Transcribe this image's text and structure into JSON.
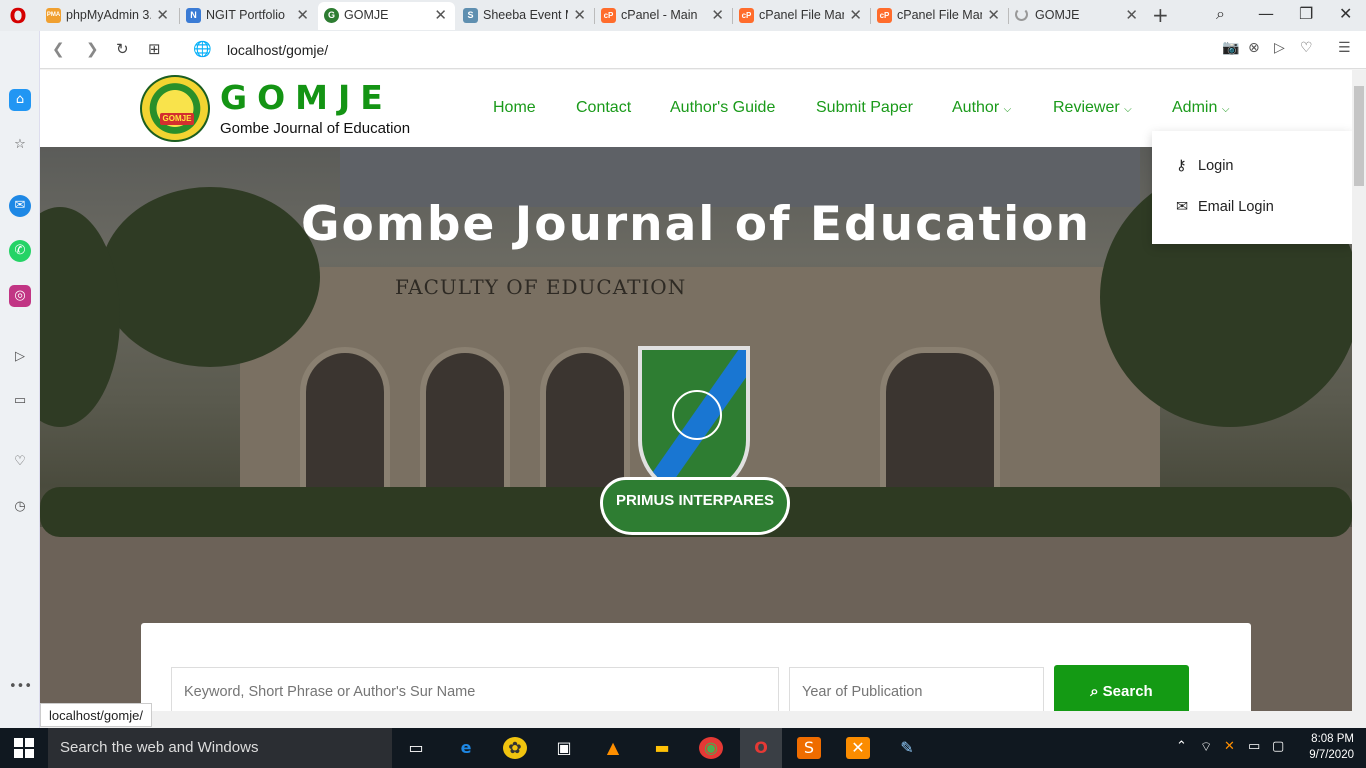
{
  "browser": {
    "tabs": [
      {
        "title": "phpMyAdmin 3.",
        "fav": "PMA",
        "color": "#f0a030"
      },
      {
        "title": "NGIT Portfolio",
        "fav": "N",
        "color": "#3a7bd5"
      },
      {
        "title": "GOMJE",
        "fav": "G",
        "color": "#2e7d32"
      },
      {
        "title": "Sheeba Event M",
        "fav": "S",
        "color": "#5f8fb0"
      },
      {
        "title": "cPanel - Main",
        "fav": "cP",
        "color": "#ff6c2c"
      },
      {
        "title": "cPanel File Man",
        "fav": "cP",
        "color": "#ff6c2c"
      },
      {
        "title": "cPanel File Man",
        "fav": "cP",
        "color": "#ff6c2c"
      },
      {
        "title": "GOMJE",
        "fav": "",
        "color": "#999999"
      }
    ],
    "url": "localhost/gomje/",
    "status_url": "localhost/gomje/"
  },
  "site": {
    "logo_title": "GOMJE",
    "logo_subtitle": "Gombe Journal of Education",
    "nav": [
      {
        "label": "Home"
      },
      {
        "label": "Contact"
      },
      {
        "label": "Author's Guide"
      },
      {
        "label": "Submit Paper"
      },
      {
        "label": "Author",
        "has_dropdown": true
      },
      {
        "label": "Reviewer",
        "has_dropdown": true
      },
      {
        "label": "Admin",
        "has_dropdown": true
      }
    ],
    "admin_menu": [
      {
        "label": "Login",
        "icon": "key-icon"
      },
      {
        "label": "Email Login",
        "icon": "envelope-icon"
      }
    ],
    "hero_title": "Gombe Journal of Education",
    "building_sign": "FACULTY OF EDUCATION",
    "crest_motto": "PRIMUS INTERPARES",
    "search": {
      "keyword_placeholder": "Keyword, Short Phrase or Author's Sur Name",
      "year_placeholder": "Year of Publication",
      "button_label": "Search"
    }
  },
  "taskbar": {
    "search_text": "Search the web and Windows",
    "time": "8:08 PM",
    "date": "9/7/2020"
  },
  "colors": {
    "brand_green": "#149a14",
    "nav_green": "#1a9a1a"
  }
}
